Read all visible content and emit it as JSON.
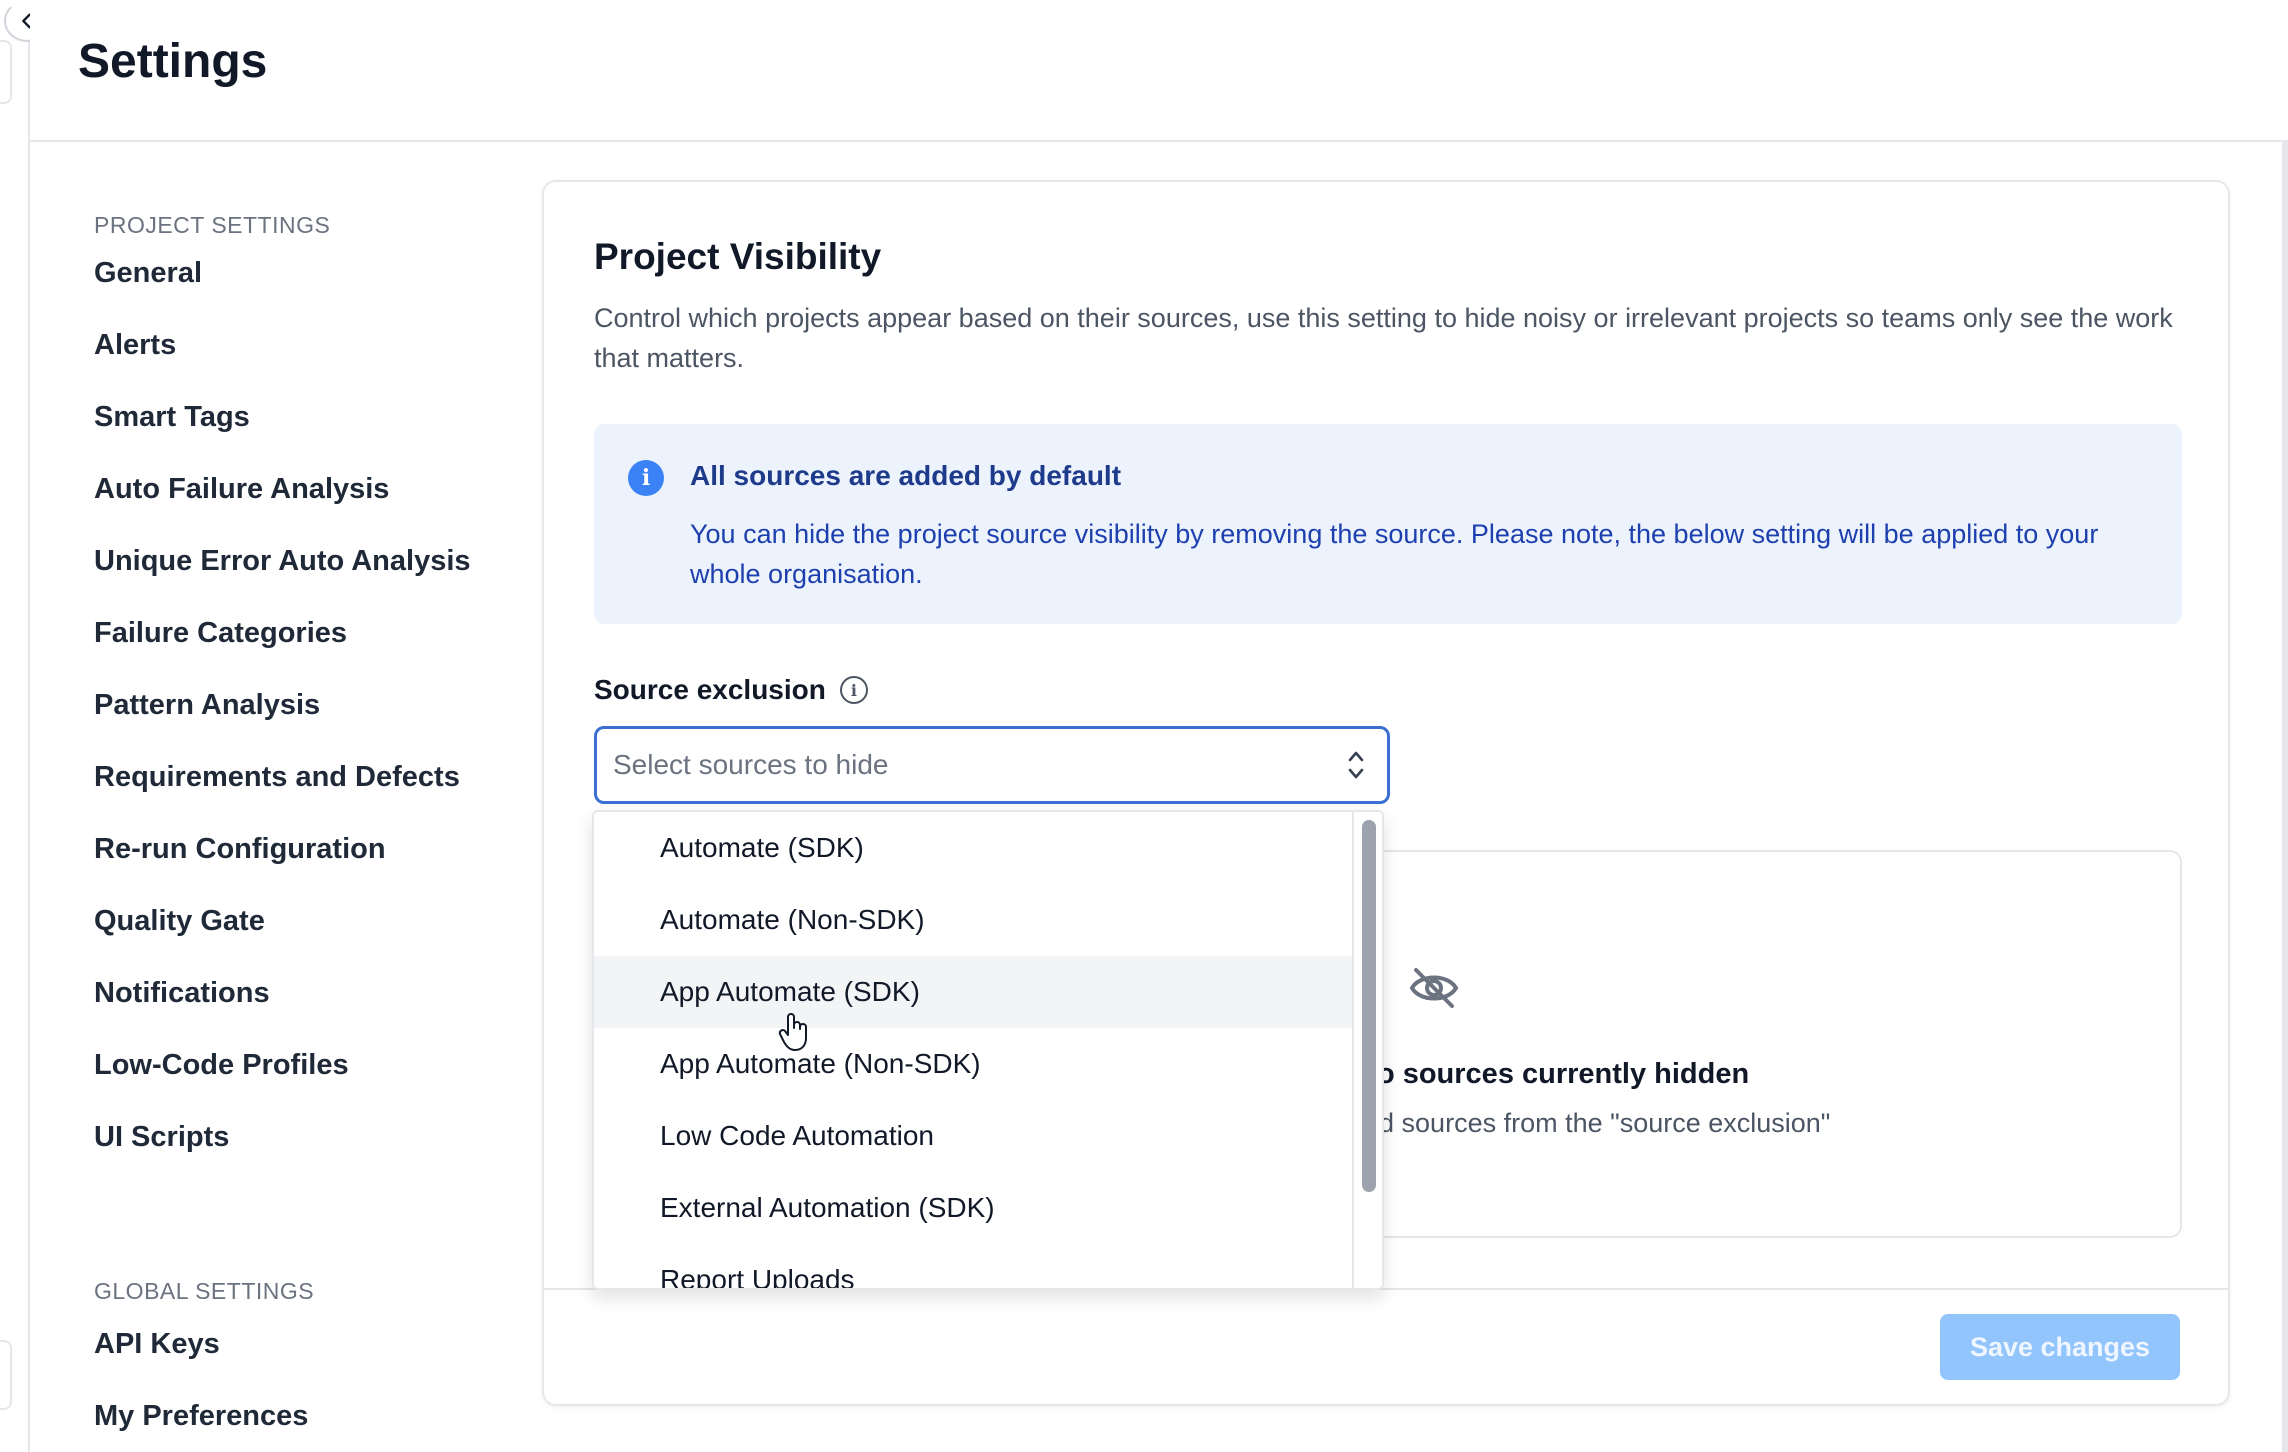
{
  "header": {
    "title": "Settings"
  },
  "sidebar": {
    "project_heading": "PROJECT SETTINGS",
    "project_items": [
      {
        "label": "General"
      },
      {
        "label": "Alerts"
      },
      {
        "label": "Smart Tags"
      },
      {
        "label": "Auto Failure Analysis"
      },
      {
        "label": "Unique Error Auto Analysis"
      },
      {
        "label": "Failure Categories"
      },
      {
        "label": "Pattern Analysis"
      },
      {
        "label": "Requirements and Defects"
      },
      {
        "label": "Re-run Configuration"
      },
      {
        "label": "Quality Gate"
      },
      {
        "label": "Notifications"
      },
      {
        "label": "Low-Code Profiles"
      },
      {
        "label": "UI Scripts"
      }
    ],
    "global_heading": "GLOBAL SETTINGS",
    "global_items": [
      {
        "label": "API Keys"
      },
      {
        "label": "My Preferences"
      }
    ]
  },
  "card": {
    "title": "Project Visibility",
    "description": "Control which projects appear based on their sources, use this setting to hide noisy or irrelevant projects so teams only see the work that matters.",
    "info": {
      "title": "All sources are added by default",
      "body": "You can hide the project source visibility by removing the source. Please note, the below setting will be applied to your whole organisation."
    },
    "source_exclusion": {
      "label": "Source exclusion",
      "placeholder": "Select sources to hide",
      "value": ""
    },
    "empty_state": {
      "title": "No sources currently hidden",
      "description": "Add sources from the \"source exclusion\""
    },
    "save_label": "Save changes"
  },
  "dropdown": {
    "options": [
      "Automate (SDK)",
      "Automate (Non-SDK)",
      "App Automate (SDK)",
      "App Automate (Non-SDK)",
      "Low Code Automation",
      "External Automation (SDK)",
      "Report Uploads"
    ],
    "hovered_index": 2
  },
  "icons": {
    "collapse": "chevron-left-icon",
    "info": "info-icon",
    "label_info": "info-outline-icon",
    "select": "chevron-up-down-icon",
    "empty_state": "eye-off-icon"
  },
  "colors": {
    "accent": "#3b6fd4",
    "info_bg": "#edf3fd",
    "info_text": "#1e40af",
    "save_disabled": "#93c5fd"
  }
}
